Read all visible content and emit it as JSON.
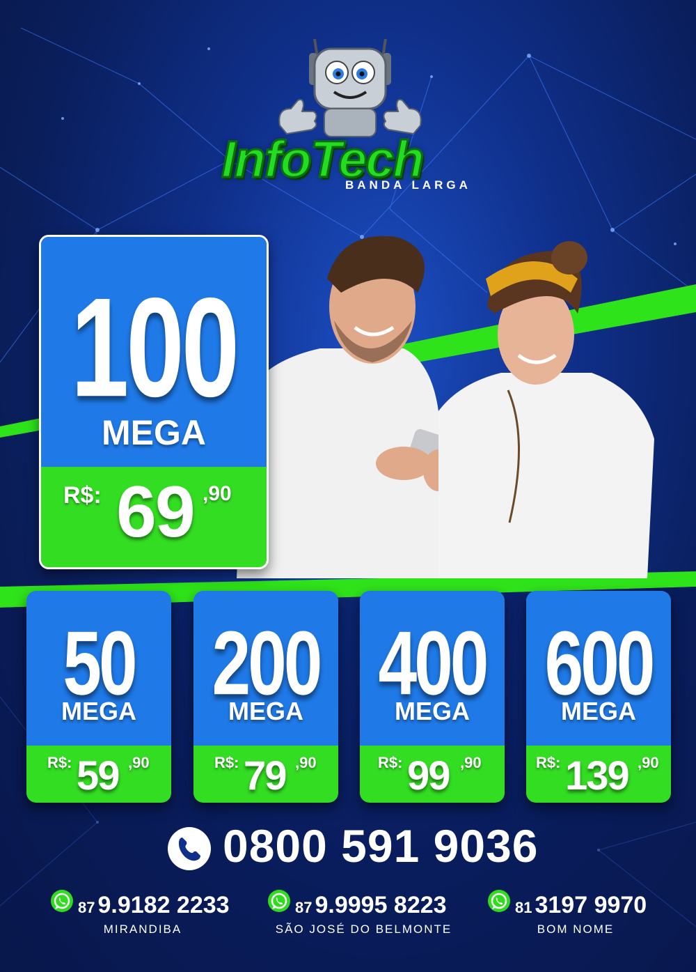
{
  "brand": {
    "name": "InfoTech",
    "subtitle": "BANDA LARGA",
    "mascot_icon": "robot-mascot-thumbs-up-icon"
  },
  "featured_plan": {
    "speed": "100",
    "unit": "MEGA",
    "currency": "R$:",
    "price": "69",
    "cents": ",90"
  },
  "plans": [
    {
      "speed": "50",
      "unit": "MEGA",
      "currency": "R$:",
      "price": "59",
      "cents": ",90"
    },
    {
      "speed": "200",
      "unit": "MEGA",
      "currency": "R$:",
      "price": "79",
      "cents": ",90"
    },
    {
      "speed": "400",
      "unit": "MEGA",
      "currency": "R$:",
      "price": "99",
      "cents": ",90"
    },
    {
      "speed": "600",
      "unit": "MEGA",
      "currency": "R$:",
      "price": "139",
      "cents": ",90"
    }
  ],
  "contact": {
    "phone_icon": "phone-icon",
    "main_phone": "0800 591 9036",
    "whatsapp_icon": "whatsapp-icon",
    "whatsapp": [
      {
        "ddd": "87",
        "number": "9.9182 2233",
        "city": "MIRANDIBA"
      },
      {
        "ddd": "87",
        "number": "9.9995 8223",
        "city": "SÃO JOSÉ DO BELMONTE"
      },
      {
        "ddd": "81",
        "number": "3197 9970",
        "city": "BOM NOME"
      }
    ]
  },
  "colors": {
    "background": "#0f2f8a",
    "card_blue": "#1f7ae8",
    "accent_green": "#33dd22",
    "logo_green": "#22dd22",
    "text": "#ffffff"
  }
}
